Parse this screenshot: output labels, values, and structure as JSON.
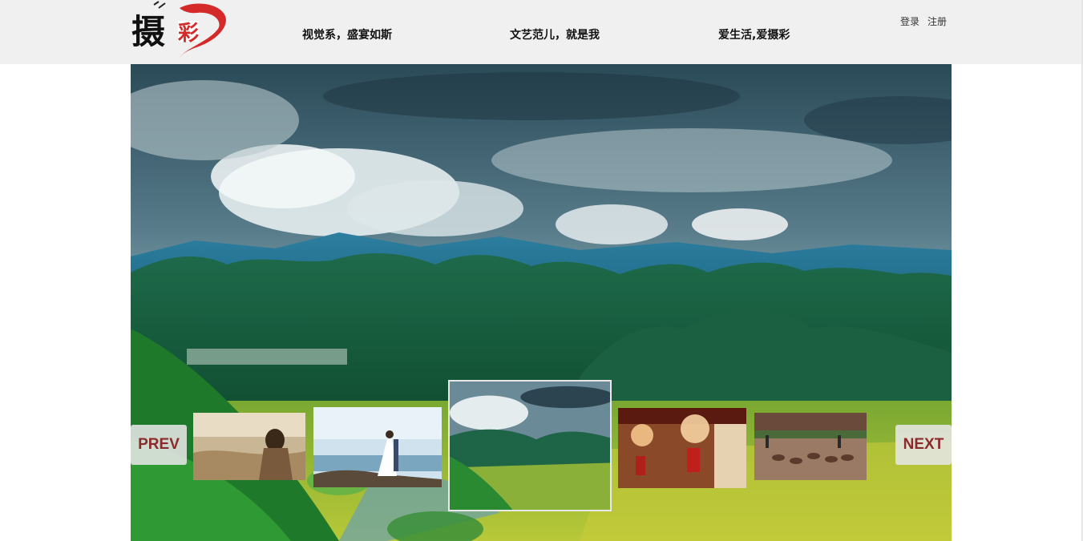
{
  "header": {
    "logo_alt": "摄彩",
    "nav": [
      {
        "label": "视觉系，盛宴如斯"
      },
      {
        "label": "文艺范儿，就是我"
      },
      {
        "label": "爱生活,爱摄彩"
      }
    ],
    "login": "登录",
    "register": "注册"
  },
  "slider": {
    "prev_label": "PREV",
    "next_label": "NEXT",
    "active_index": 2,
    "thumbnails": [
      {
        "name": "portrait-in-field-photo"
      },
      {
        "name": "wedding-on-seashore-photo"
      },
      {
        "name": "mountain-valley-photo"
      },
      {
        "name": "chandelier-interior-photo"
      },
      {
        "name": "farm-field-photo"
      }
    ]
  },
  "colors": {
    "header_bg": "#f0f0f0",
    "accent": "#8a2b2b",
    "logo_red": "#d42a2a"
  }
}
